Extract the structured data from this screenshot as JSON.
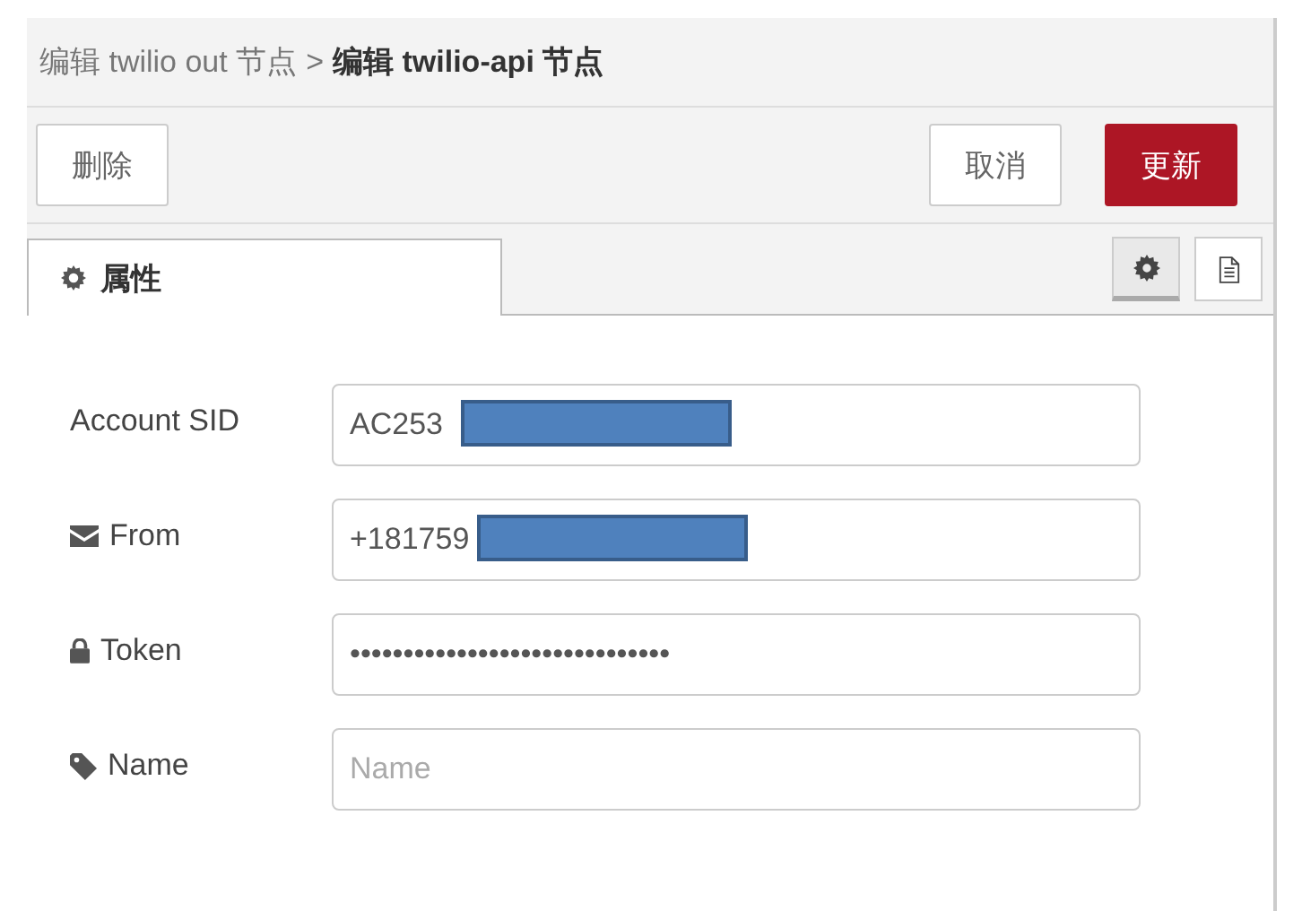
{
  "breadcrumb": [
    {
      "text": "编辑 twilio out 节点",
      "current": false
    },
    {
      "text": "编辑 twilio-api 节点",
      "current": true
    }
  ],
  "breadcrumb_separator": ">",
  "toolbar": {
    "left": [
      {
        "label": "删除",
        "kind": "default"
      }
    ],
    "right": [
      {
        "label": "取消",
        "kind": "default"
      },
      {
        "label": "更新",
        "kind": "primary"
      }
    ]
  },
  "tabs": [
    {
      "label": "属性",
      "selected": true
    }
  ],
  "view_buttons": [
    {
      "selected": true
    },
    {
      "selected": false
    }
  ],
  "fields": [
    {
      "label": "Account SID",
      "value": "AC253",
      "redacted": true
    },
    {
      "label": "From",
      "value": "+181759",
      "redacted": true
    },
    {
      "label": "Token",
      "value": "••••••••••••••••••••••••••••••",
      "redacted": false
    },
    {
      "label": "Name",
      "placeholder": "Name",
      "redacted": false
    }
  ]
}
